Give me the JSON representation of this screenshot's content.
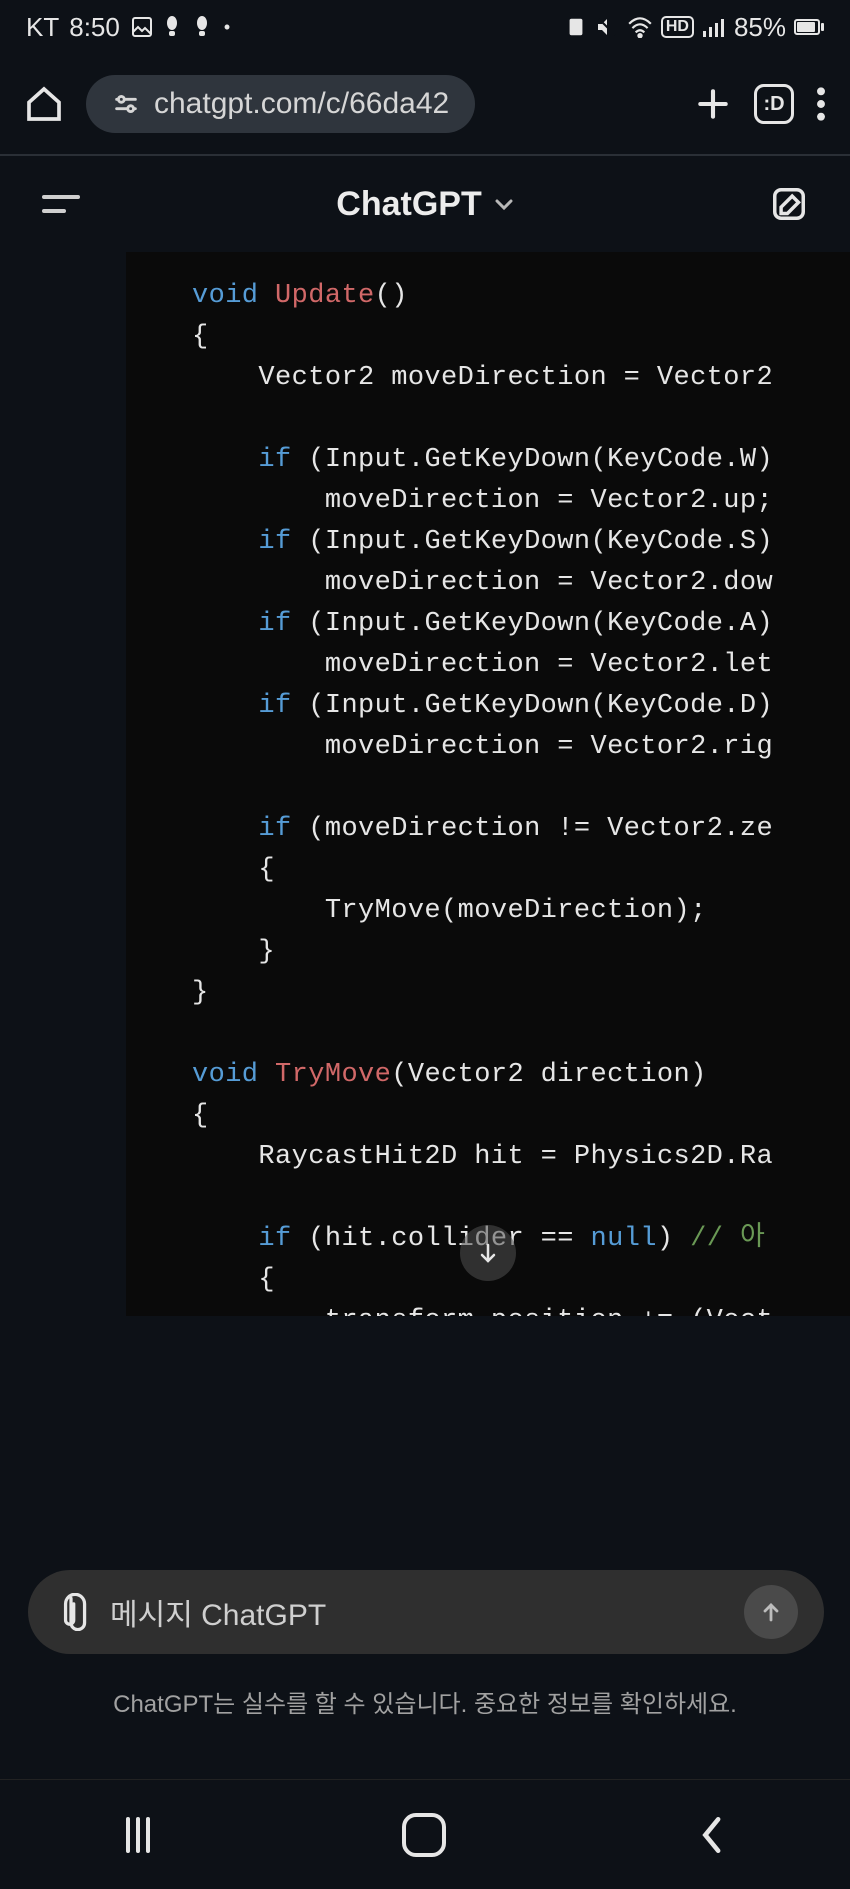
{
  "status": {
    "carrier": "KT",
    "time": "8:50",
    "battery": "85%",
    "hd": "HD"
  },
  "browser": {
    "url": "chatgpt.com/c/66da42",
    "tab_badge": ":D"
  },
  "app": {
    "title": "ChatGPT"
  },
  "code": {
    "l1_kw": "void",
    "l1_fn": "Update",
    "l1_rest": "()",
    "l2": "{",
    "l3": "    Vector2 moveDirection = Vector2",
    "l4": "",
    "l5_kw": "if",
    "l5_rest": " (Input.GetKeyDown(KeyCode.W)",
    "l6": "        moveDirection = Vector2.up;",
    "l7_kw": "if",
    "l7_rest": " (Input.GetKeyDown(KeyCode.S)",
    "l8": "        moveDirection = Vector2.dow",
    "l9_kw": "if",
    "l9_rest": " (Input.GetKeyDown(KeyCode.A)",
    "l10": "        moveDirection = Vector2.let",
    "l11_kw": "if",
    "l11_rest": " (Input.GetKeyDown(KeyCode.D)",
    "l12": "        moveDirection = Vector2.rig",
    "l13": "",
    "l14_kw": "if",
    "l14_rest": " (moveDirection != Vector2.ze",
    "l15": "    {",
    "l16": "        TryMove(moveDirection);",
    "l17": "    }",
    "l18": "}",
    "l19": "",
    "l20_kw": "void",
    "l20_fn": "TryMove",
    "l20_rest": "(Vector2 direction)",
    "l21": "{",
    "l22": "    RaycastHit2D hit = Physics2D.Ra",
    "l23": "",
    "l24_kw": "if",
    "l24_mid": " (hit.collider == ",
    "l24_null": "null",
    "l24_paren": ") ",
    "l24_cm": "// 아",
    "l25": "    {",
    "l26": "        transform.position += (Vect"
  },
  "input": {
    "placeholder": "메시지 ChatGPT"
  },
  "disclaimer": "ChatGPT는 실수를 할 수 있습니다. 중요한 정보를 확인하세요."
}
